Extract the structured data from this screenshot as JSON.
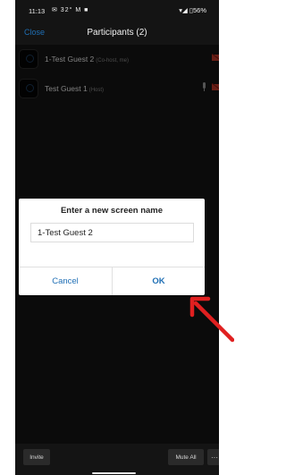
{
  "status_bar": {
    "time": "11:13",
    "notifications": "✉ 32° M ■",
    "battery": "▾◢ ▯56%"
  },
  "nav": {
    "close_label": "Close",
    "title": "Participants (2)"
  },
  "participants": [
    {
      "name": "1-Test Guest 2",
      "role": "(Co-host, me)"
    },
    {
      "name": "Test Guest 1",
      "role": "(Host)"
    }
  ],
  "dialog": {
    "title": "Enter a new screen name",
    "input_value": "1-Test Guest 2",
    "cancel_label": "Cancel",
    "ok_label": "OK"
  },
  "bottom_bar": {
    "invite_label": "Invite",
    "mute_all_label": "Mute All",
    "more_label": "···"
  },
  "colors": {
    "accent": "#1f6fb5",
    "background": "#141414",
    "annotation_arrow": "#e02020"
  }
}
